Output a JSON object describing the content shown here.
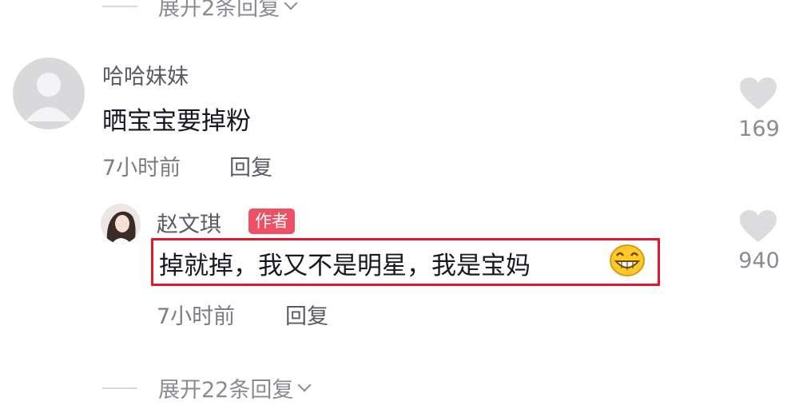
{
  "top_expand": {
    "label": "展开2条回复"
  },
  "comment": {
    "username": "哈哈妹妹",
    "text": "晒宝宝要掉粉",
    "time": "7小时前",
    "reply_label": "回复",
    "likes": "169"
  },
  "reply": {
    "username": "赵文琪",
    "badge": "作者",
    "text": "掉就掉，我又不是明星，我是宝妈",
    "emoji": "grinning-face-icon",
    "time": "7小时前",
    "reply_label": "回复",
    "likes": "940"
  },
  "bottom_expand": {
    "label": "展开22条回复"
  },
  "colors": {
    "badge": "#f05064",
    "highlight_border": "#e01a2a",
    "heart": "#dcdcdf"
  }
}
